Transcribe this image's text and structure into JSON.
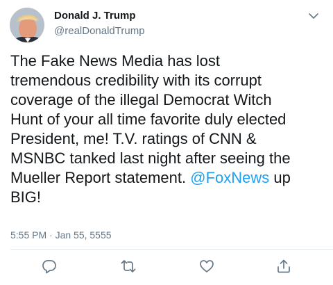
{
  "author": {
    "display_name": "Donald J. Trump",
    "handle": "@realDonaldTrump"
  },
  "tweet": {
    "lines": [
      "The Fake News Media has lost",
      "tremendous credibility with its corrupt",
      "coverage of the illegal Democrat Witch",
      "Hunt of your all time favorite duly elected",
      "President, me! T.V. ratings of CNN &",
      "MSNBC tanked last night after seeing the"
    ],
    "line7_before": "Mueller Report statement. ",
    "mention": "@FoxNews",
    "line7_after": " up",
    "line8": "BIG!",
    "timestamp": "5:55 PM · Jan 55, 5555"
  },
  "icons": {
    "menu": "chevron-down-icon",
    "reply": "reply-icon",
    "retweet": "retweet-icon",
    "like": "heart-icon",
    "share": "share-icon"
  },
  "colors": {
    "text": "#14171a",
    "secondary": "#657786",
    "link": "#1da1f2",
    "divider": "#e1e8ed"
  }
}
